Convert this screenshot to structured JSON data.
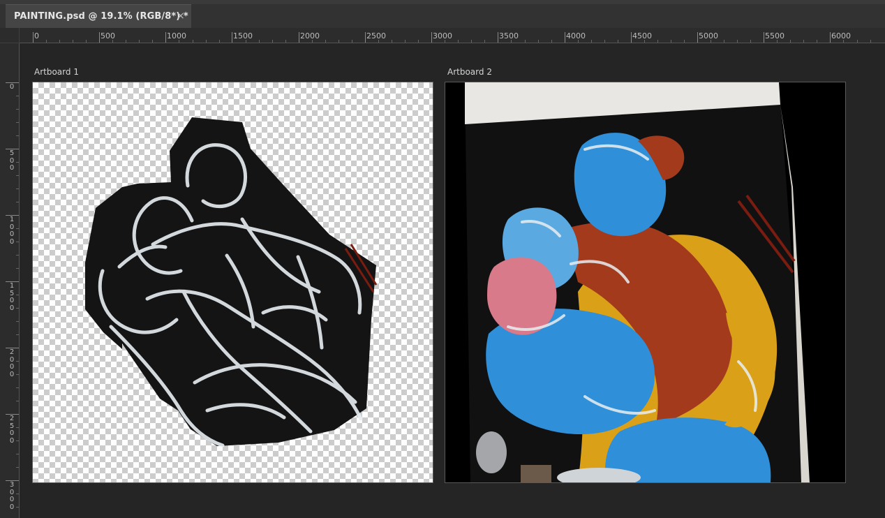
{
  "document_tab": {
    "title": "PAINTING.psd @ 19.1% (RGB/8*) *",
    "close_glyph": "×"
  },
  "ruler_horizontal": {
    "labels": [
      "0",
      "500",
      "1000",
      "1500",
      "2000",
      "2500",
      "3000",
      "3500",
      "4000",
      "4500",
      "5000",
      "5500",
      "6000"
    ]
  },
  "ruler_vertical": {
    "labels": [
      "0",
      "500",
      "1000",
      "1500",
      "2000",
      "2500",
      "3000"
    ]
  },
  "artboards": [
    {
      "label": "Artboard 1",
      "content": "transparent-with-black-cutout-line-painting"
    },
    {
      "label": "Artboard 2",
      "content": "color-painting-photo"
    }
  ],
  "colors": {
    "app_bg": "#252525",
    "tab_active": "#454545",
    "painting_black": "#141414",
    "paint_blue": "#2f8fd8",
    "paint_yellow": "#d9a018",
    "paint_red": "#a33a1c",
    "stroke_white": "#e8eef2"
  }
}
